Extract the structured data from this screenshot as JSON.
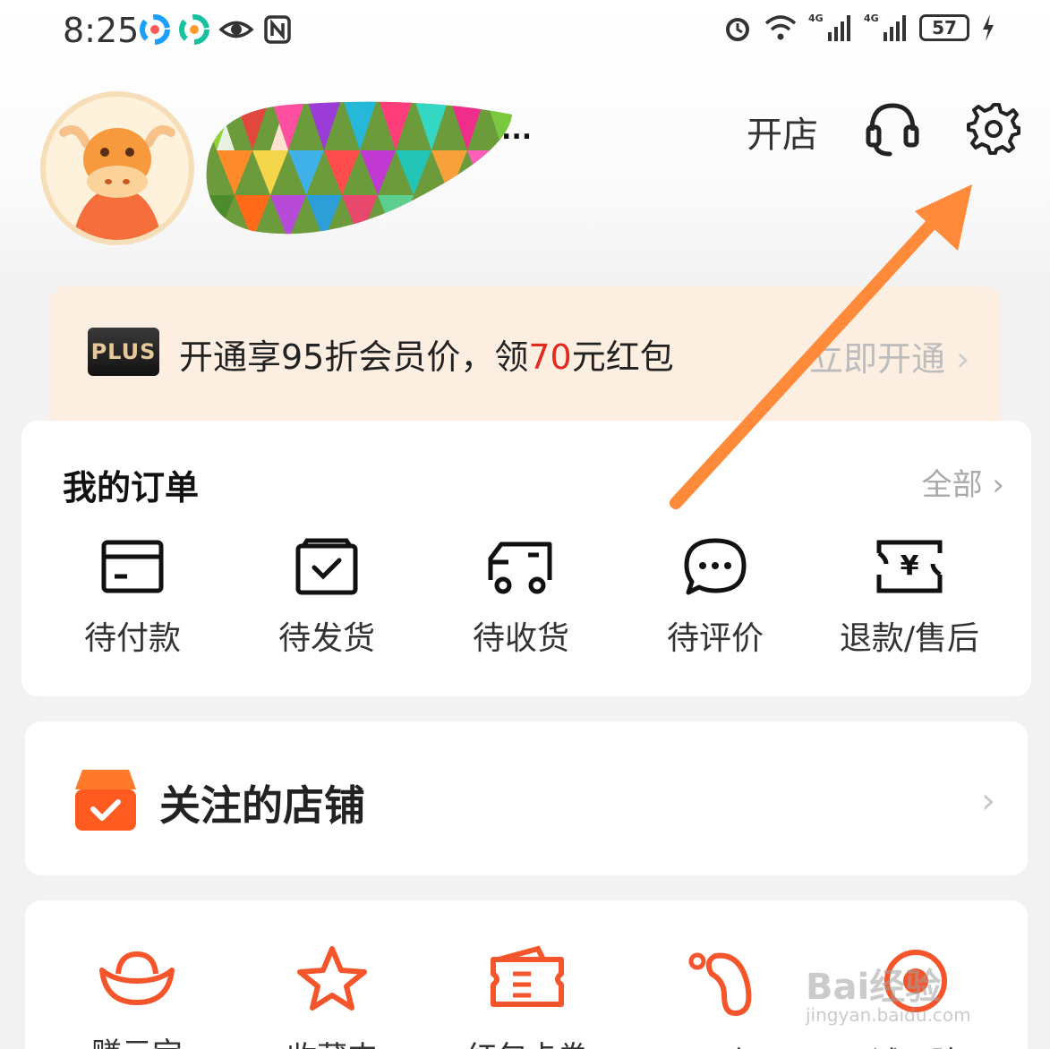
{
  "status_bar": {
    "time": "8:25",
    "battery": "57",
    "network_1": "4G",
    "network_2": "4G"
  },
  "header": {
    "username_visible": "...",
    "open_shop": "开店"
  },
  "plus_banner": {
    "badge": "PLUS",
    "text_part1": "开通享95折会员价，领",
    "text_highlight": "70",
    "text_part2": "元红包",
    "cta": "立即开通"
  },
  "orders": {
    "title": "我的订单",
    "all_link": "全部",
    "items": [
      {
        "label": "待付款",
        "icon": "wallet-icon"
      },
      {
        "label": "待发货",
        "icon": "package-check-icon"
      },
      {
        "label": "待收货",
        "icon": "truck-icon"
      },
      {
        "label": "待评价",
        "icon": "chat-bubble-icon"
      },
      {
        "label": "退款/售后",
        "icon": "refund-icon"
      }
    ]
  },
  "followed_shops": {
    "title": "关注的店铺"
  },
  "quick_links": {
    "items": [
      {
        "label": "赚元宝",
        "icon": "ingot-icon"
      },
      {
        "label": "收藏夹",
        "icon": "star-icon"
      },
      {
        "label": "红包卡券",
        "icon": "coupon-icon"
      },
      {
        "label": "足迹",
        "icon": "footprint-icon"
      },
      {
        "label": "试一阶",
        "icon": "trial-icon"
      }
    ]
  },
  "watermark": {
    "text": "Bai经验",
    "sub": "jingyan.baidu.com"
  },
  "colors": {
    "accent_orange": "#ff6a1a",
    "highlight_red": "#e02b20",
    "annotation_arrow": "#ff8a3a"
  }
}
